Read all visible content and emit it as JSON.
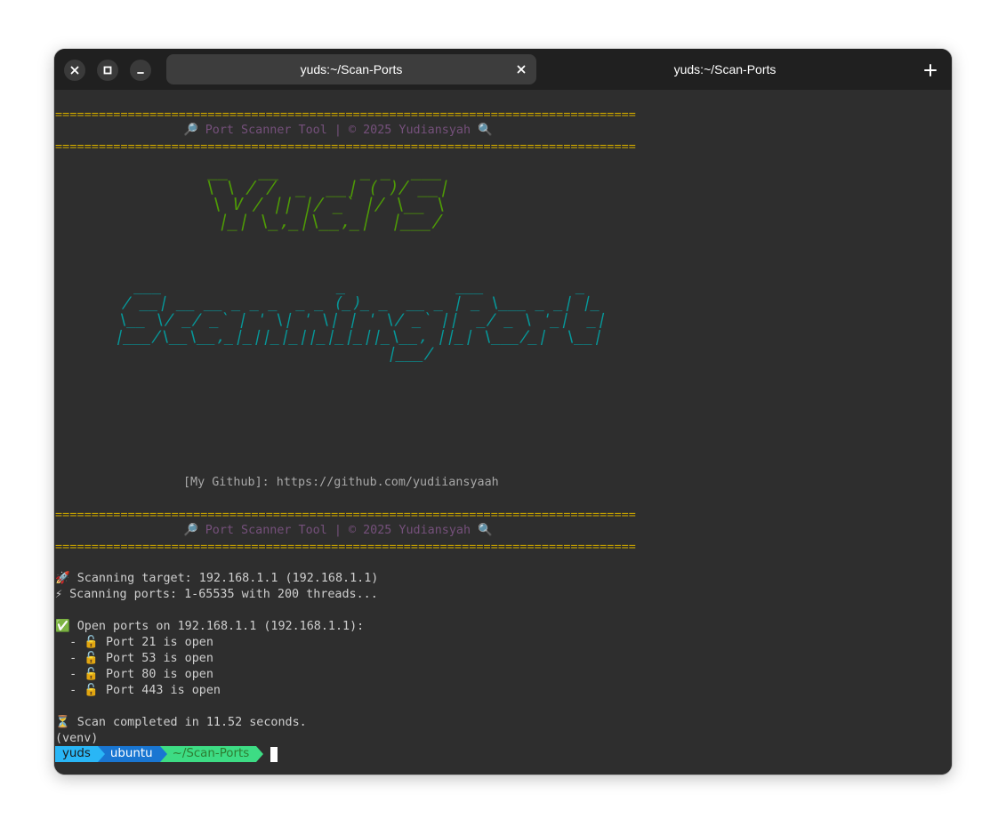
{
  "window": {
    "tabs": [
      {
        "title": "yuds:~/Scan-Ports",
        "active": true
      },
      {
        "title": "yuds:~/Scan-Ports",
        "active": false
      }
    ]
  },
  "terminal": {
    "separator": "================================================================================",
    "header": "🔎 Port Scanner Tool | © 2025 Yudiansyah 🔍",
    "ascii_yuds": "__   __        _ _  ___ \n\\ \\ / /  _  __| ( )/ __|\n \\ V / || |/ _` |/ \\__ \\\n  |_| \\_,_|\\__,_|  |___/",
    "ascii_scanning": "  ___                   _            ___          _   \n / __| __ __ _ _ _  _ _ (_)_ _  __ _ | _ \\___ _ _| |_ \n \\__ \\/ _/ _` | ' \\| ' \\| | ' \\/ _` ||  _/ _ \\ '_|  _|\n |___/\\__\\__,_|_||_|_||_|_|_||_\\__, ||_| \\___/_|  \\__|\n                               |___/                  ",
    "github_line": "[My Github]: https://github.com/yudiiansyaah",
    "scan_target": "🚀 Scanning target: 192.168.1.1 (192.168.1.1)",
    "scan_ports": "⚡ Scanning ports: 1-65535 with 200 threads...",
    "open_ports_header": "✅ Open ports on 192.168.1.1 (192.168.1.1):",
    "open_ports": [
      "  - 🔓 Port 21 is open",
      "  - 🔓 Port 53 is open",
      "  - 🔓 Port 80 is open",
      "  - 🔓 Port 443 is open"
    ],
    "completed": "⏳ Scan completed in 11.52 seconds.",
    "venv": "(venv)",
    "prompt": {
      "user": "yuds",
      "host": "ubuntu",
      "path": "~/Scan-Ports"
    }
  },
  "colors": {
    "separator": "#c4a000",
    "header": "#75507b",
    "ascii_yuds": "#4e9a06",
    "ascii_scanning": "#06989a",
    "prompt_user_bg": "#29b6f6",
    "prompt_host_bg": "#1976d2",
    "prompt_path_bg": "#3ddc84"
  }
}
